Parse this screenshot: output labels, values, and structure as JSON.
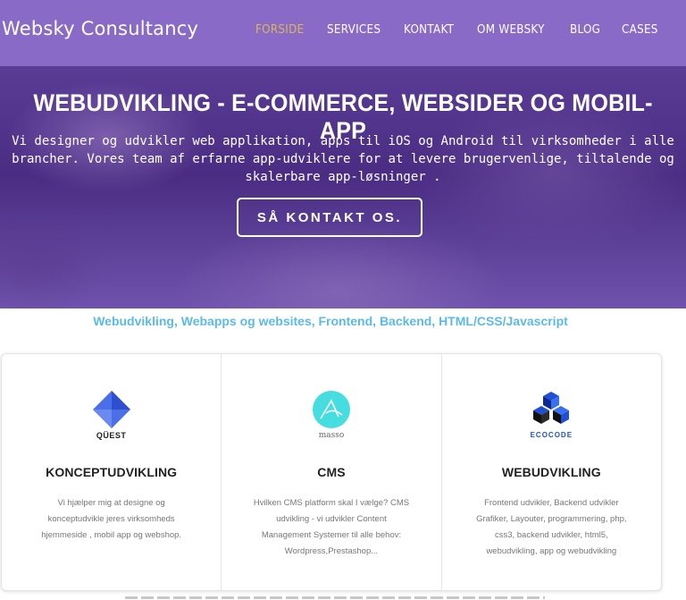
{
  "header": {
    "brand": "Websky Consultancy",
    "nav": [
      "FORSIDE",
      "SERVICES",
      "KONTAKT",
      "OM WEBSKY",
      "BLOG",
      "CASES"
    ],
    "active_nav": "FORSIDE",
    "bg_color": "#8a6ac7",
    "active_color": "#d8b55a"
  },
  "hero": {
    "title": "WEBUDVIKLING - E-COMMERCE, WEBSIDER OG MOBIL-APP",
    "text_line1": "Vi designer og udvikler web applikation, apps til iOS og Android til virksomheder i alle",
    "text_line2": "brancher. Vores team af erfarne app-udviklere for at levere brugervenlige, tiltalende og",
    "text_line3": "skalerbare app-løsninger .",
    "button_label": "SÅ KONTAKT OS."
  },
  "tagline": "Webudvikling, Webapps og websites, Frontend, Backend, HTML/CSS/Javascript",
  "cards": [
    {
      "logo_icon": "quest-diamond-logo-icon",
      "logo_label": "QÜEST",
      "title": "KONCEPTUDVIKLING",
      "text_lines": [
        "Vi hjælper mig at designe og",
        "konceptudvikle jeres virksomheds",
        "hjemmeside , mobil app og webshop."
      ]
    },
    {
      "logo_icon": "masso-circle-logo-icon",
      "logo_label": "masso",
      "title": "CMS",
      "text_lines": [
        "Hvilken CMS platform skal I vælge? CMS",
        "udvikling - vi udvikler Content",
        "Management Systemer til alle behov:",
        "Wordpress,Prestashop..."
      ]
    },
    {
      "logo_icon": "ecocode-cubes-logo-icon",
      "logo_label": "ECOCODE",
      "title": "WEBUDVIKLING",
      "text_lines": [
        "Frontend udvikler, Backend udvikler",
        "Grafiker, Layouter, programmering, php,",
        "css3, backend udvikler, html5,",
        "webudvikling, app og webudvikling"
      ]
    }
  ]
}
